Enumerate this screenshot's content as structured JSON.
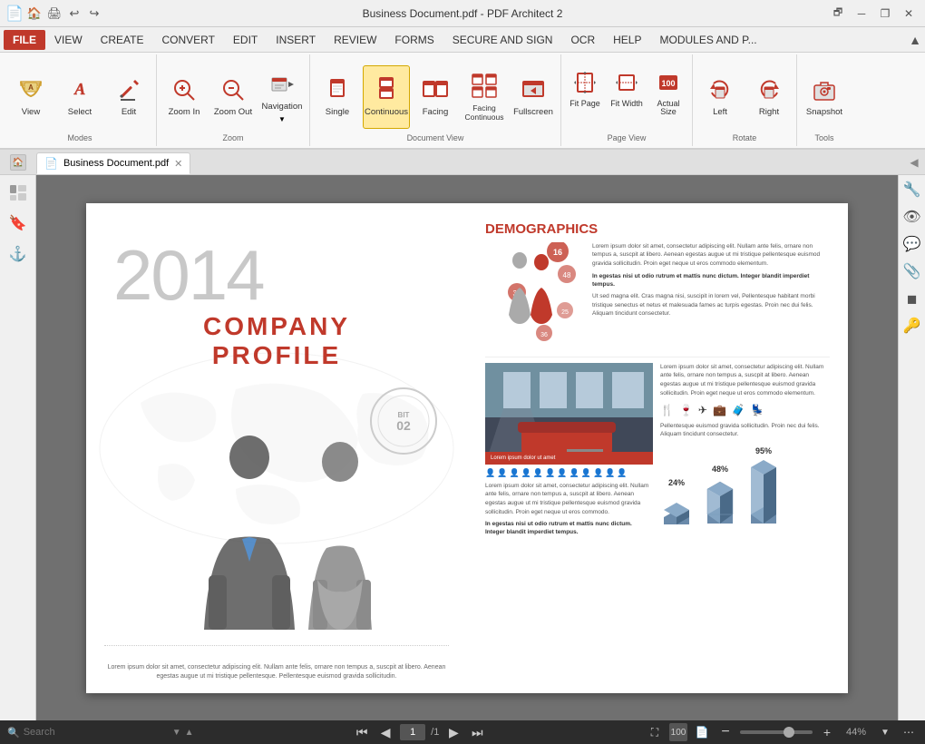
{
  "titlebar": {
    "app_icon": "📄",
    "nav_icons": [
      "🏠",
      "🖨",
      "↩",
      "↪"
    ],
    "title": "Business Document.pdf  -  PDF Architect 2",
    "win_btns": [
      "🗗",
      "─",
      "❐",
      "✕"
    ]
  },
  "menu": {
    "items": [
      "FILE",
      "VIEW",
      "CREATE",
      "CONVERT",
      "EDIT",
      "INSERT",
      "REVIEW",
      "FORMS",
      "SECURE AND SIGN",
      "OCR",
      "HELP",
      "MODULES AND P..."
    ],
    "active": "VIEW"
  },
  "toolbar": {
    "groups": [
      {
        "label": "Modes",
        "buttons": [
          {
            "id": "view",
            "label": "View",
            "icon": "👁"
          },
          {
            "id": "select",
            "label": "Select",
            "icon": "A"
          },
          {
            "id": "edit",
            "label": "Edit",
            "icon": "✏"
          }
        ]
      },
      {
        "label": "Zoom",
        "buttons": [
          {
            "id": "zoom-in",
            "label": "Zoom In",
            "icon": "🔍+"
          },
          {
            "id": "zoom-out",
            "label": "Zoom Out",
            "icon": "🔍-"
          },
          {
            "id": "navigation",
            "label": "Navigation",
            "icon": "🧭"
          }
        ]
      },
      {
        "label": "Document View",
        "buttons": [
          {
            "id": "single",
            "label": "Single",
            "icon": "📄"
          },
          {
            "id": "continuous",
            "label": "Continuous",
            "icon": "📋"
          },
          {
            "id": "facing",
            "label": "Facing",
            "icon": "📰"
          },
          {
            "id": "facing-continuous",
            "label": "Facing Continuous",
            "icon": "📑"
          },
          {
            "id": "fullscreen",
            "label": "Fullscreen",
            "icon": "⛶"
          }
        ]
      },
      {
        "label": "Page View",
        "buttons": [
          {
            "id": "fit-page",
            "label": "Fit Page",
            "icon": "⊡"
          },
          {
            "id": "fit-width",
            "label": "Fit Width",
            "icon": "↔"
          },
          {
            "id": "actual-size",
            "label": "Actual Size",
            "icon": "100"
          }
        ]
      },
      {
        "label": "Rotate",
        "buttons": [
          {
            "id": "left",
            "label": "Left",
            "icon": "↺"
          },
          {
            "id": "right",
            "label": "Right",
            "icon": "↻"
          }
        ]
      },
      {
        "label": "Tools",
        "buttons": [
          {
            "id": "snapshot",
            "label": "Snapshot",
            "icon": "📷"
          }
        ]
      }
    ]
  },
  "tabs": {
    "items": [
      {
        "id": "business-doc",
        "label": "Business Document.pdf",
        "active": true
      }
    ]
  },
  "left_sidebar": {
    "icons": [
      "☰",
      "🔖",
      "⚓"
    ]
  },
  "right_tools": {
    "icons": [
      "🔧",
      "👁",
      "💬",
      "📎",
      "◼",
      "🔑"
    ]
  },
  "document": {
    "left_page": {
      "year": "2014",
      "title_line1": "COMPANY",
      "title_line2": "PROFILE",
      "caption": "Lorem ipsum dolor sit amet, consectetur adipiscing elit. Nullam ante felis, ornare non tempus a, suscpit at libero. Aenean egestas augue ut mi tristique pellentesque. Pellentesque euismod gravida sollicitudin."
    },
    "right_page": {
      "section": "DEMOGRAPHICS",
      "body1": "Lorem ipsum dolor sit amet, consectetur adipiscing elit. Nullam ante felis, ornare non tempus a, suscpit at libero. Aenean egestas augue ut mi tristique pellentesque euismod gravida sollicitudin. Proin eget neque ut eros commodo elementum.",
      "bold1": "In egestas nisi ut odio rutrum et mattis nunc dictum. Integer blandit imperdiet tempus.",
      "body2": "Ut sed magna elit. Cras magna nisi, suscipit in lorem vel, Pellentesque habitant morbi tristique senectus et netus et malesuada fames ac turpis egestas. Proin nec dui felis. Aliquam tincidunt consectetur.",
      "image_caption": "Lorem ipsum dolor ut amet",
      "body3": "Lorem ipsum dolor sit amet, consectetur adipiscing elit. Nullam ante felis, ornare non tempus a, suscpit at libero. Aenean egestas augue ut mi tristique pellentesque euismod gravida sollicitudin. Proin eget neque ut eros commodo.",
      "bold2": "In egestas nisi ut odio rutrum et mattis nunc dictum. Integer blandit imperdiet tempus.",
      "body4": "Lorem ipsum dolor sit amet, consectetur adipiscing elit. Nullam ante felis, ornare non tempus a, suscpit at libero. Aenean egestas augue ut mi tristique pellentesque euismod gravida sollicitudin. Proin eget neque ut eros commodo elementum.",
      "body5": "Pellentesque euismod gravida sollicitudin. Proin nec dui felis. Aliquam tincidunt consectetur.",
      "stats": [
        "24%",
        "48%",
        "95%"
      ]
    }
  },
  "statusbar": {
    "search_placeholder": "Search",
    "page_current": "1",
    "page_total": "/1",
    "zoom": "44%"
  }
}
